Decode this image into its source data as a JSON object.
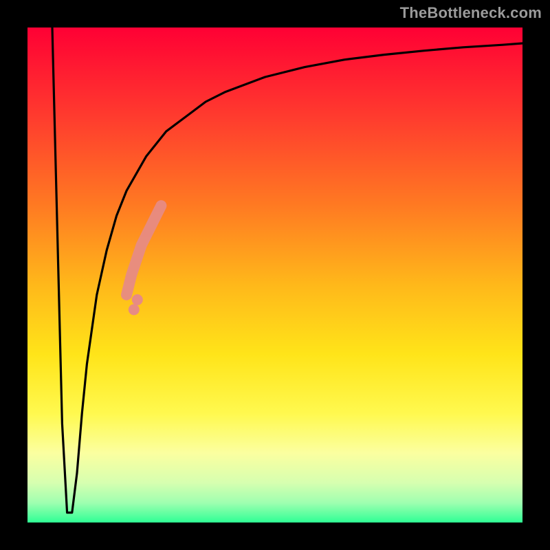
{
  "watermark": "TheBottleneck.com",
  "chart_data": {
    "type": "line",
    "title": "",
    "xlabel": "",
    "ylabel": "",
    "xlim": [
      0,
      100
    ],
    "ylim": [
      0,
      100
    ],
    "grid": false,
    "legend": false,
    "series": [
      {
        "name": "bottleneck-curve",
        "color": "#000000",
        "x": [
          5,
          6,
          7,
          8,
          9,
          10,
          11,
          12,
          14,
          16,
          18,
          20,
          24,
          28,
          32,
          36,
          40,
          48,
          56,
          64,
          72,
          80,
          88,
          96,
          100
        ],
        "y": [
          100,
          60,
          20,
          2,
          2,
          10,
          22,
          32,
          46,
          55,
          62,
          67,
          74,
          79,
          82,
          85,
          87,
          90,
          92,
          93.5,
          94.5,
          95.3,
          96,
          96.5,
          96.8
        ]
      }
    ],
    "highlight_segment": {
      "name": "salmon-band",
      "color": "#e78b84",
      "x": [
        20,
        21,
        22,
        23,
        24,
        25,
        26,
        27
      ],
      "y": [
        46,
        50,
        53,
        56,
        58,
        60,
        62,
        64
      ]
    },
    "highlight_dots": {
      "name": "salmon-dots",
      "color": "#e78b84",
      "points": [
        {
          "x": 21.5,
          "y": 43
        },
        {
          "x": 22.2,
          "y": 45
        }
      ]
    }
  }
}
